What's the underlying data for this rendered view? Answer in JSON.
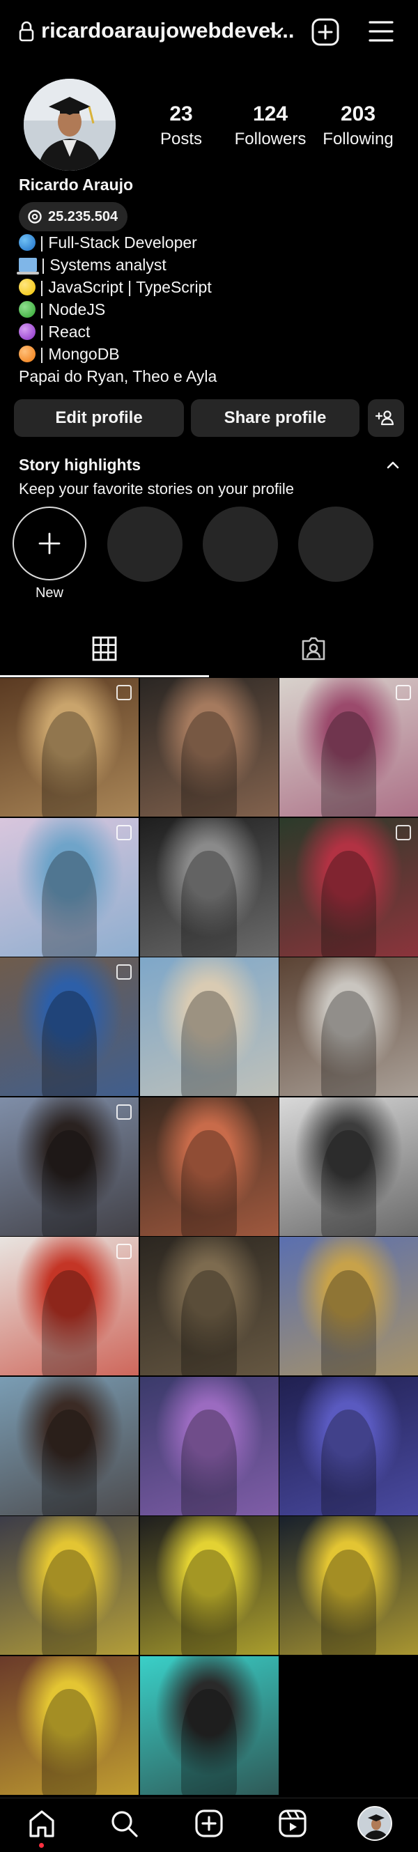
{
  "header": {
    "username": "ricardoaraujowebdevel...",
    "lock_icon": "lock-icon",
    "dropdown_icon": "chevron-down-icon",
    "create_icon": "plus-square-icon",
    "menu_icon": "hamburger-icon"
  },
  "profile": {
    "name": "Ricardo Araujo",
    "threads_badge": "25.235.504",
    "stats": [
      {
        "value": "23",
        "label": "Posts"
      },
      {
        "value": "124",
        "label": "Followers"
      },
      {
        "value": "203",
        "label": "Following"
      }
    ],
    "bio": [
      {
        "icon": "globe-icon",
        "text": "| Full-Stack Developer"
      },
      {
        "icon": "laptop-icon",
        "text": "| Systems analyst"
      },
      {
        "icon": "yellow-circle-icon",
        "text": "| JavaScript | TypeScript"
      },
      {
        "icon": "green-circle-icon",
        "text": "| NodeJS"
      },
      {
        "icon": "purple-circle-icon",
        "text": "| React"
      },
      {
        "icon": "orange-circle-icon",
        "text": "| MongoDB"
      },
      {
        "icon": "",
        "text": "Papai do Ryan, Theo e Ayla"
      }
    ]
  },
  "actions": {
    "edit_profile": "Edit profile",
    "share_profile": "Share profile",
    "add_person_icon": "add-person-icon"
  },
  "highlights": {
    "title": "Story highlights",
    "subtitle": "Keep your favorite stories on your profile",
    "new_label": "New"
  },
  "tabs": [
    "grid-icon",
    "tagged-icon"
  ],
  "posts": [
    {
      "colors": [
        "#5a3a22",
        "#c9a46c"
      ],
      "multi": true
    },
    {
      "colors": [
        "#2a2623",
        "#a57a5e"
      ],
      "multi": false
    },
    {
      "colors": [
        "#d8d2cc",
        "#9b4a6c"
      ],
      "multi": true
    },
    {
      "colors": [
        "#d9c6dd",
        "#6fa4c9"
      ],
      "multi": true
    },
    {
      "colors": [
        "#1e1e1e",
        "#8a8a8a"
      ],
      "multi": false
    },
    {
      "colors": [
        "#2b3a2a",
        "#b23243"
      ],
      "multi": true
    },
    {
      "colors": [
        "#6f5c4c",
        "#2d5fa8"
      ],
      "multi": true
    },
    {
      "colors": [
        "#7ea7c9",
        "#d9cbb3"
      ],
      "multi": false
    },
    {
      "colors": [
        "#5b4334",
        "#c9c5bf"
      ],
      "multi": false
    },
    {
      "colors": [
        "#7f8ea8",
        "#2a2220"
      ],
      "multi": true
    },
    {
      "colors": [
        "#3a2a20",
        "#c86b4a"
      ],
      "multi": false
    },
    {
      "colors": [
        "#d9d9d9",
        "#3d3d3d"
      ],
      "multi": false
    },
    {
      "colors": [
        "#e8e4e0",
        "#c43526"
      ],
      "multi": true
    },
    {
      "colors": [
        "#2b2620",
        "#7d6b4f"
      ],
      "multi": false
    },
    {
      "colors": [
        "#5a6fb0",
        "#c7a24a"
      ],
      "multi": false
    },
    {
      "colors": [
        "#7a9db4",
        "#3b2b25"
      ],
      "multi": false
    },
    {
      "colors": [
        "#3a3a6a",
        "#9b6bc0"
      ],
      "multi": false
    },
    {
      "colors": [
        "#202050",
        "#5a5ac0"
      ],
      "multi": false
    },
    {
      "colors": [
        "#3c3c48",
        "#e3c533"
      ],
      "multi": false
    },
    {
      "colors": [
        "#1e1e1e",
        "#e3d233"
      ],
      "multi": false
    },
    {
      "colors": [
        "#18202c",
        "#e3c533"
      ],
      "multi": false
    },
    {
      "colors": [
        "#6a3a2a",
        "#e3c533"
      ],
      "multi": false
    },
    {
      "colors": [
        "#3ad0c8",
        "#2a2a2a"
      ],
      "multi": false
    }
  ],
  "nav": [
    "home-icon",
    "search-icon",
    "create-icon",
    "reels-icon",
    "profile-avatar"
  ],
  "colors": {
    "background": "#000000",
    "button": "#262626",
    "text": "#f5f5f5",
    "notification_dot": "#ff3040"
  }
}
